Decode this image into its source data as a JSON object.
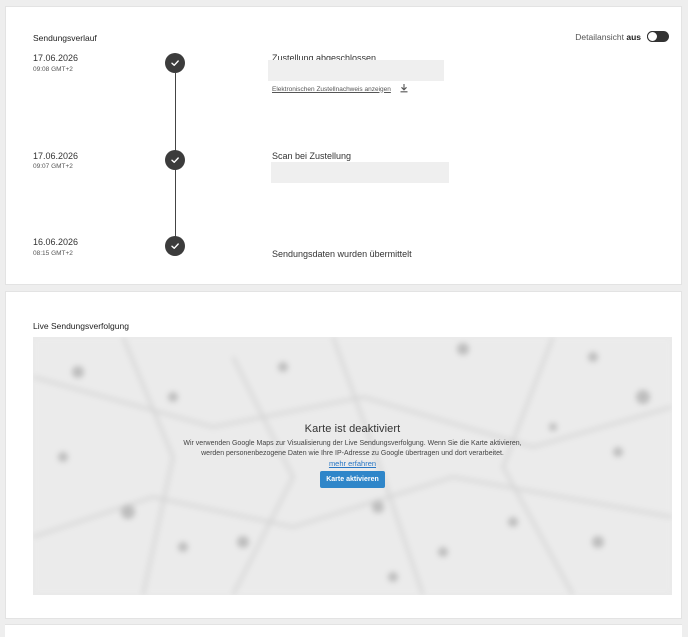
{
  "history": {
    "title": "Sendungsverlauf",
    "detail_label": "Detailansicht",
    "detail_state": "aus",
    "events": [
      {
        "date": "17.06.2026",
        "time": "09:08 GMT+2",
        "title": "Zustellung abgeschlossen",
        "link": "Elektronischen Zustellnachweis anzeigen"
      },
      {
        "date": "17.06.2026",
        "time": "09:07 GMT+2",
        "title": "Scan bei Zustellung"
      },
      {
        "date": "16.06.2026",
        "time": "08:15 GMT+2",
        "title": "Sendungsdaten wurden übermittelt"
      }
    ]
  },
  "live": {
    "title": "Live Sendungsverfolgung",
    "map_heading": "Karte ist deaktiviert",
    "map_text": "Wir verwenden Google Maps zur Visualisierung der Live Sendungsverfolgung. Wenn Sie die Karte aktivieren, werden personenbezogene Daten wie Ihre IP-Adresse zu Google übertragen und dort verarbeitet.",
    "more_link": "mehr erfahren",
    "activate_button": "Karte aktivieren"
  },
  "colors": {
    "accent": "#2f86c9",
    "link": "#2776c4",
    "check": "#3c3c3c"
  },
  "icons": [
    "check-icon",
    "download-icon",
    "toggle-switch"
  ]
}
